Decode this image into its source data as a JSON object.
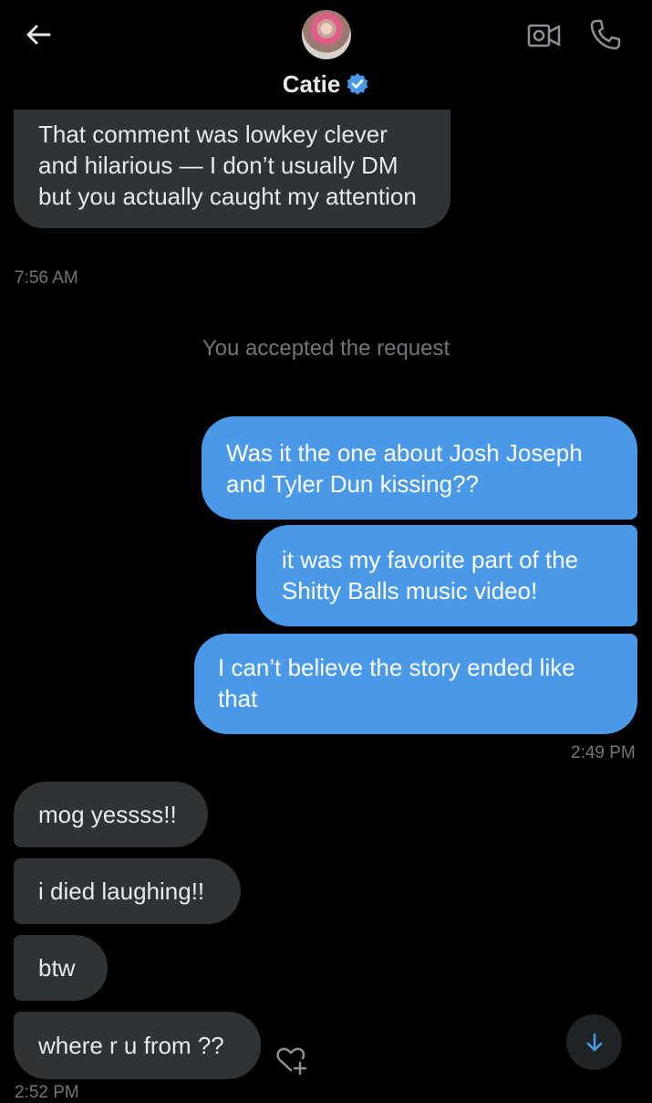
{
  "header": {
    "contact_name": "Catie",
    "back_icon": "arrow-left-icon",
    "video_icon": "video-call-icon",
    "phone_icon": "phone-icon",
    "verified_icon": "verified-badge-icon",
    "accent_color": "#4a99e9"
  },
  "messages": {
    "m1": "That comment was lowkey clever and hilarious — I don’t usually DM but you actually caught my attention",
    "t1": "7:56 AM",
    "system": "You accepted the request",
    "m2": "Was it the one about Josh Joseph and Tyler Dun kissing??",
    "m3": "it was my favorite part of the Shitty Balls music video!",
    "m4": "I can’t believe the story ended like that",
    "t2": "2:49 PM",
    "m5": "mog yessss!!",
    "m6": "i died laughing!!",
    "m7": "btw",
    "m8": "where r u from ??",
    "t3": "2:52 PM"
  },
  "colors": {
    "incoming_bubble": "#2f3336",
    "outgoing_bubble": "#4a99e9",
    "background": "#000000",
    "timestamp": "#71767b"
  }
}
